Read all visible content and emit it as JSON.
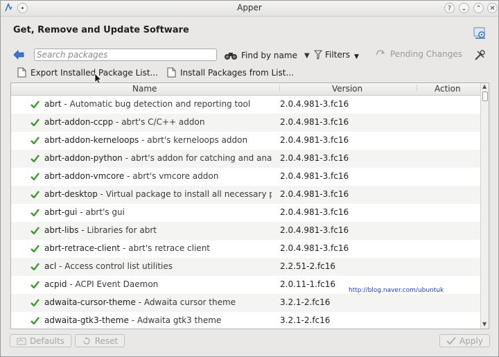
{
  "window": {
    "title": "Apper"
  },
  "heading": "Get, Remove and Update Software",
  "toolbar": {
    "search_placeholder": "Search packages",
    "find_by": "Find by name",
    "filters": "Filters",
    "pending": "Pending Changes"
  },
  "actions": {
    "export": "Export Installed Package List...",
    "install": "Install Packages from List..."
  },
  "table": {
    "columns": [
      "Name",
      "Version",
      "Action"
    ],
    "rows": [
      {
        "name": "abrt",
        "desc": " - Automatic bug detection and reporting tool",
        "version": "2.0.4.981-3.fc16"
      },
      {
        "name": "abrt-addon-ccpp",
        "desc": " - abrt's C/C++ addon",
        "version": "2.0.4.981-3.fc16"
      },
      {
        "name": "abrt-addon-kerneloops",
        "desc": " - abrt's kerneloops addon",
        "version": "2.0.4.981-3.fc16"
      },
      {
        "name": "abrt-addon-python",
        "desc": " - abrt's addon for catching and analyzi",
        "version": "2.0.4.981-3.fc16"
      },
      {
        "name": "abrt-addon-vmcore",
        "desc": " - abrt's vmcore addon",
        "version": "2.0.4.981-3.fc16"
      },
      {
        "name": "abrt-desktop",
        "desc": " - Virtual package to install all necessary pac",
        "version": "2.0.4.981-3.fc16"
      },
      {
        "name": "abrt-gui",
        "desc": " - abrt's gui",
        "version": "2.0.4.981-3.fc16"
      },
      {
        "name": "abrt-libs",
        "desc": " - Libraries for abrt",
        "version": "2.0.4.981-3.fc16"
      },
      {
        "name": "abrt-retrace-client",
        "desc": " - abrt's retrace client",
        "version": "2.0.4.981-3.fc16"
      },
      {
        "name": "acl",
        "desc": " - Access control list utilities",
        "version": "2.2.51-2.fc16"
      },
      {
        "name": "acpid",
        "desc": " - ACPI Event Daemon",
        "version": "2.0.11-1.fc16"
      },
      {
        "name": "adwaita-cursor-theme",
        "desc": " - Adwaita cursor theme",
        "version": "3.2.1-2.fc16"
      },
      {
        "name": "adwaita-gtk3-theme",
        "desc": " - Adwaita gtk3 theme",
        "version": "3.2.1-2.fc16"
      }
    ]
  },
  "watermark": "http://blog.naver.com/ubuntuk",
  "bottom": {
    "defaults": "Defaults",
    "reset": "Reset",
    "apply": "Apply"
  },
  "colors": {
    "check": "#3a9a2a",
    "accent": "#2e6fd0",
    "disabled_text": "#a5a5a5"
  }
}
